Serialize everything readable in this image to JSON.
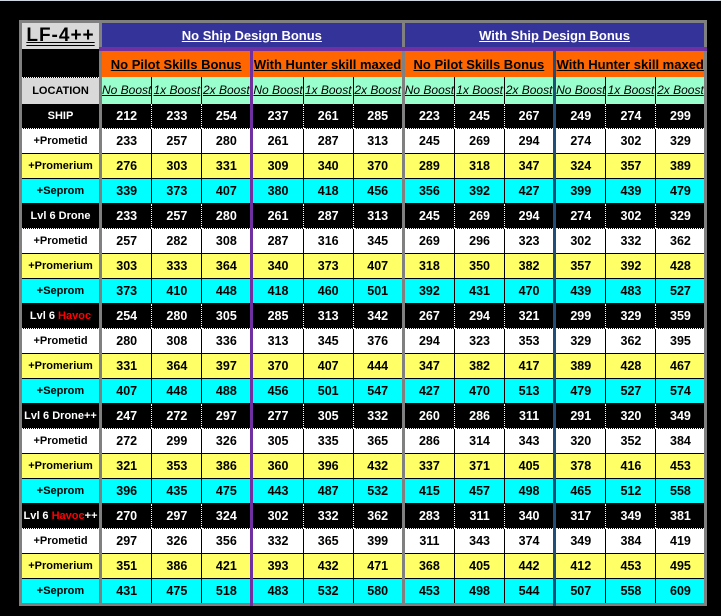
{
  "title": "LF-4++",
  "ship_design_headers": [
    "No Ship Design Bonus",
    "With Ship Design Bonus"
  ],
  "pilot_headers": [
    "No Pilot Skills Bonus",
    "With Hunter skill maxed",
    "No Pilot Skills Bonus",
    "With Hunter skill maxed"
  ],
  "location_header": "LOCATION",
  "boost_headers": [
    "No Boost",
    "1x Boost",
    "2x Boost",
    "No Boost",
    "1x Boost",
    "2x Boost",
    "No Boost",
    "1x Boost",
    "2x Boost",
    "No Boost",
    "1x Boost",
    "2x Boost"
  ],
  "colors": {
    "ship_header": "#333399",
    "pilot_header": "#ff6600",
    "boost_header": "#99ffcc",
    "base_row": "#000000",
    "prometid_row": "#ffffff",
    "promerium_row": "#ffff66",
    "seprom_row": "#00ffff",
    "havoc_text": "#ff0000"
  },
  "rows": [
    {
      "label": "SHIP",
      "label_red": "",
      "label_suffix": "",
      "style": "black",
      "values": [
        212,
        233,
        254,
        237,
        261,
        285,
        223,
        245,
        267,
        249,
        274,
        299
      ]
    },
    {
      "label": "+Prometid",
      "label_red": "",
      "label_suffix": "",
      "style": "white",
      "values": [
        233,
        257,
        280,
        261,
        287,
        313,
        245,
        269,
        294,
        274,
        302,
        329
      ]
    },
    {
      "label": "+Promerium",
      "label_red": "",
      "label_suffix": "",
      "style": "yellow",
      "values": [
        276,
        303,
        331,
        309,
        340,
        370,
        289,
        318,
        347,
        324,
        357,
        389
      ]
    },
    {
      "label": "+Seprom",
      "label_red": "",
      "label_suffix": "",
      "style": "cyan",
      "values": [
        339,
        373,
        407,
        380,
        418,
        456,
        356,
        392,
        427,
        399,
        439,
        479
      ]
    },
    {
      "label": "Lvl 6 Drone",
      "label_red": "",
      "label_suffix": "",
      "style": "black",
      "values": [
        233,
        257,
        280,
        261,
        287,
        313,
        245,
        269,
        294,
        274,
        302,
        329
      ]
    },
    {
      "label": "+Prometid",
      "label_red": "",
      "label_suffix": "",
      "style": "white",
      "values": [
        257,
        282,
        308,
        287,
        316,
        345,
        269,
        296,
        323,
        302,
        332,
        362
      ]
    },
    {
      "label": "+Promerium",
      "label_red": "",
      "label_suffix": "",
      "style": "yellow",
      "values": [
        303,
        333,
        364,
        340,
        373,
        407,
        318,
        350,
        382,
        357,
        392,
        428
      ]
    },
    {
      "label": "+Seprom",
      "label_red": "",
      "label_suffix": "",
      "style": "cyan",
      "values": [
        373,
        410,
        448,
        418,
        460,
        501,
        392,
        431,
        470,
        439,
        483,
        527
      ]
    },
    {
      "label": "Lvl 6 ",
      "label_red": "Havoc",
      "label_suffix": "",
      "style": "black",
      "values": [
        254,
        280,
        305,
        285,
        313,
        342,
        267,
        294,
        321,
        299,
        329,
        359
      ]
    },
    {
      "label": "+Prometid",
      "label_red": "",
      "label_suffix": "",
      "style": "white",
      "values": [
        280,
        308,
        336,
        313,
        345,
        376,
        294,
        323,
        353,
        329,
        362,
        395
      ]
    },
    {
      "label": "+Promerium",
      "label_red": "",
      "label_suffix": "",
      "style": "yellow",
      "values": [
        331,
        364,
        397,
        370,
        407,
        444,
        347,
        382,
        417,
        389,
        428,
        467
      ]
    },
    {
      "label": "+Seprom",
      "label_red": "",
      "label_suffix": "",
      "style": "cyan",
      "values": [
        407,
        448,
        488,
        456,
        501,
        547,
        427,
        470,
        513,
        479,
        527,
        574
      ]
    },
    {
      "label": "Lvl 6 Drone++",
      "label_red": "",
      "label_suffix": "",
      "style": "black",
      "values": [
        247,
        272,
        297,
        277,
        305,
        332,
        260,
        286,
        311,
        291,
        320,
        349
      ]
    },
    {
      "label": "+Prometid",
      "label_red": "",
      "label_suffix": "",
      "style": "white",
      "values": [
        272,
        299,
        326,
        305,
        335,
        365,
        286,
        314,
        343,
        320,
        352,
        384
      ]
    },
    {
      "label": "+Promerium",
      "label_red": "",
      "label_suffix": "",
      "style": "yellow",
      "values": [
        321,
        353,
        386,
        360,
        396,
        432,
        337,
        371,
        405,
        378,
        416,
        453
      ]
    },
    {
      "label": "+Seprom",
      "label_red": "",
      "label_suffix": "",
      "style": "cyan",
      "values": [
        396,
        435,
        475,
        443,
        487,
        532,
        415,
        457,
        498,
        465,
        512,
        558
      ]
    },
    {
      "label": "Lvl 6 ",
      "label_red": "Havoc",
      "label_suffix": "++",
      "style": "black",
      "values": [
        270,
        297,
        324,
        302,
        332,
        362,
        283,
        311,
        340,
        317,
        349,
        381
      ]
    },
    {
      "label": "+Prometid",
      "label_red": "",
      "label_suffix": "",
      "style": "white",
      "values": [
        297,
        326,
        356,
        332,
        365,
        399,
        311,
        343,
        374,
        349,
        384,
        419
      ]
    },
    {
      "label": "+Promerium",
      "label_red": "",
      "label_suffix": "",
      "style": "yellow",
      "values": [
        351,
        386,
        421,
        393,
        432,
        471,
        368,
        405,
        442,
        412,
        453,
        495
      ]
    },
    {
      "label": "+Seprom",
      "label_red": "",
      "label_suffix": "",
      "style": "cyan",
      "values": [
        431,
        475,
        518,
        483,
        532,
        580,
        453,
        498,
        544,
        507,
        558,
        609
      ]
    }
  ]
}
